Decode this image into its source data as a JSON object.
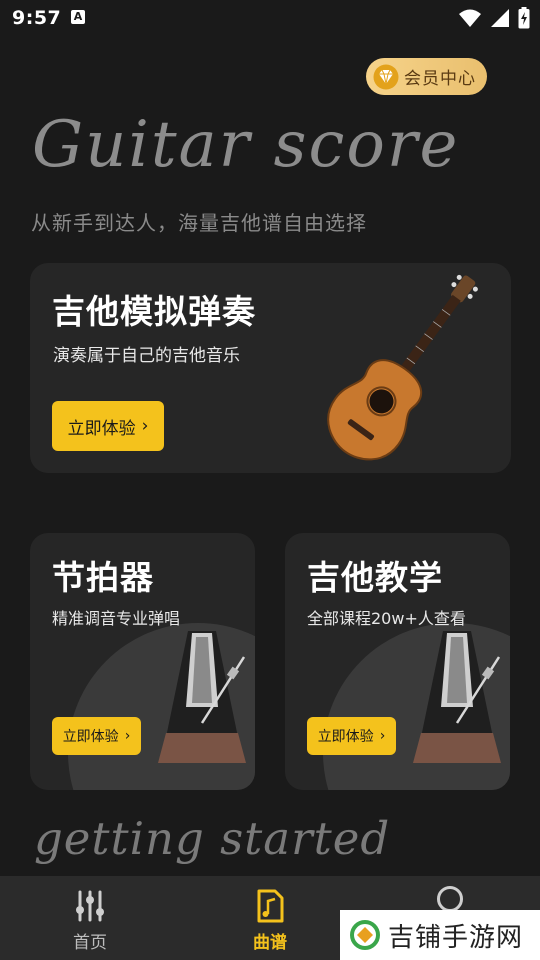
{
  "status_bar": {
    "time": "9:57",
    "notification_badge": "A"
  },
  "vip": {
    "label": "会员中心",
    "icon": "diamond-icon",
    "color": "#f6d38a"
  },
  "hero": {
    "script_title": "Guitar score",
    "subtitle": "从新手到达人，海量吉他谱自由选择"
  },
  "main_card": {
    "title": "吉他模拟弹奏",
    "description": "演奏属于自己的吉他音乐",
    "button_label": "立即体验",
    "image": "acoustic-guitar-image"
  },
  "metronome_card": {
    "title": "节拍器",
    "description": "精准调音专业弹唱",
    "button_label": "立即体验",
    "image": "metronome-image"
  },
  "teaching_card": {
    "title": "吉他教学",
    "description": "全部课程20w+人查看",
    "button_label": "立即体验",
    "image": "metronome-image"
  },
  "footer_script": "getting started",
  "bottom_nav": {
    "items": [
      {
        "label": "首页",
        "icon": "sliders-icon",
        "active": false
      },
      {
        "label": "曲谱",
        "icon": "music-score-icon",
        "active": true
      },
      {
        "label": "",
        "icon": "profile-icon",
        "active": false
      }
    ]
  },
  "watermark": {
    "text": "吉铺手游网",
    "icon": "watermark-logo"
  },
  "colors": {
    "accent": "#f4c21c",
    "background": "#1a1a1a",
    "card": "#262626"
  }
}
